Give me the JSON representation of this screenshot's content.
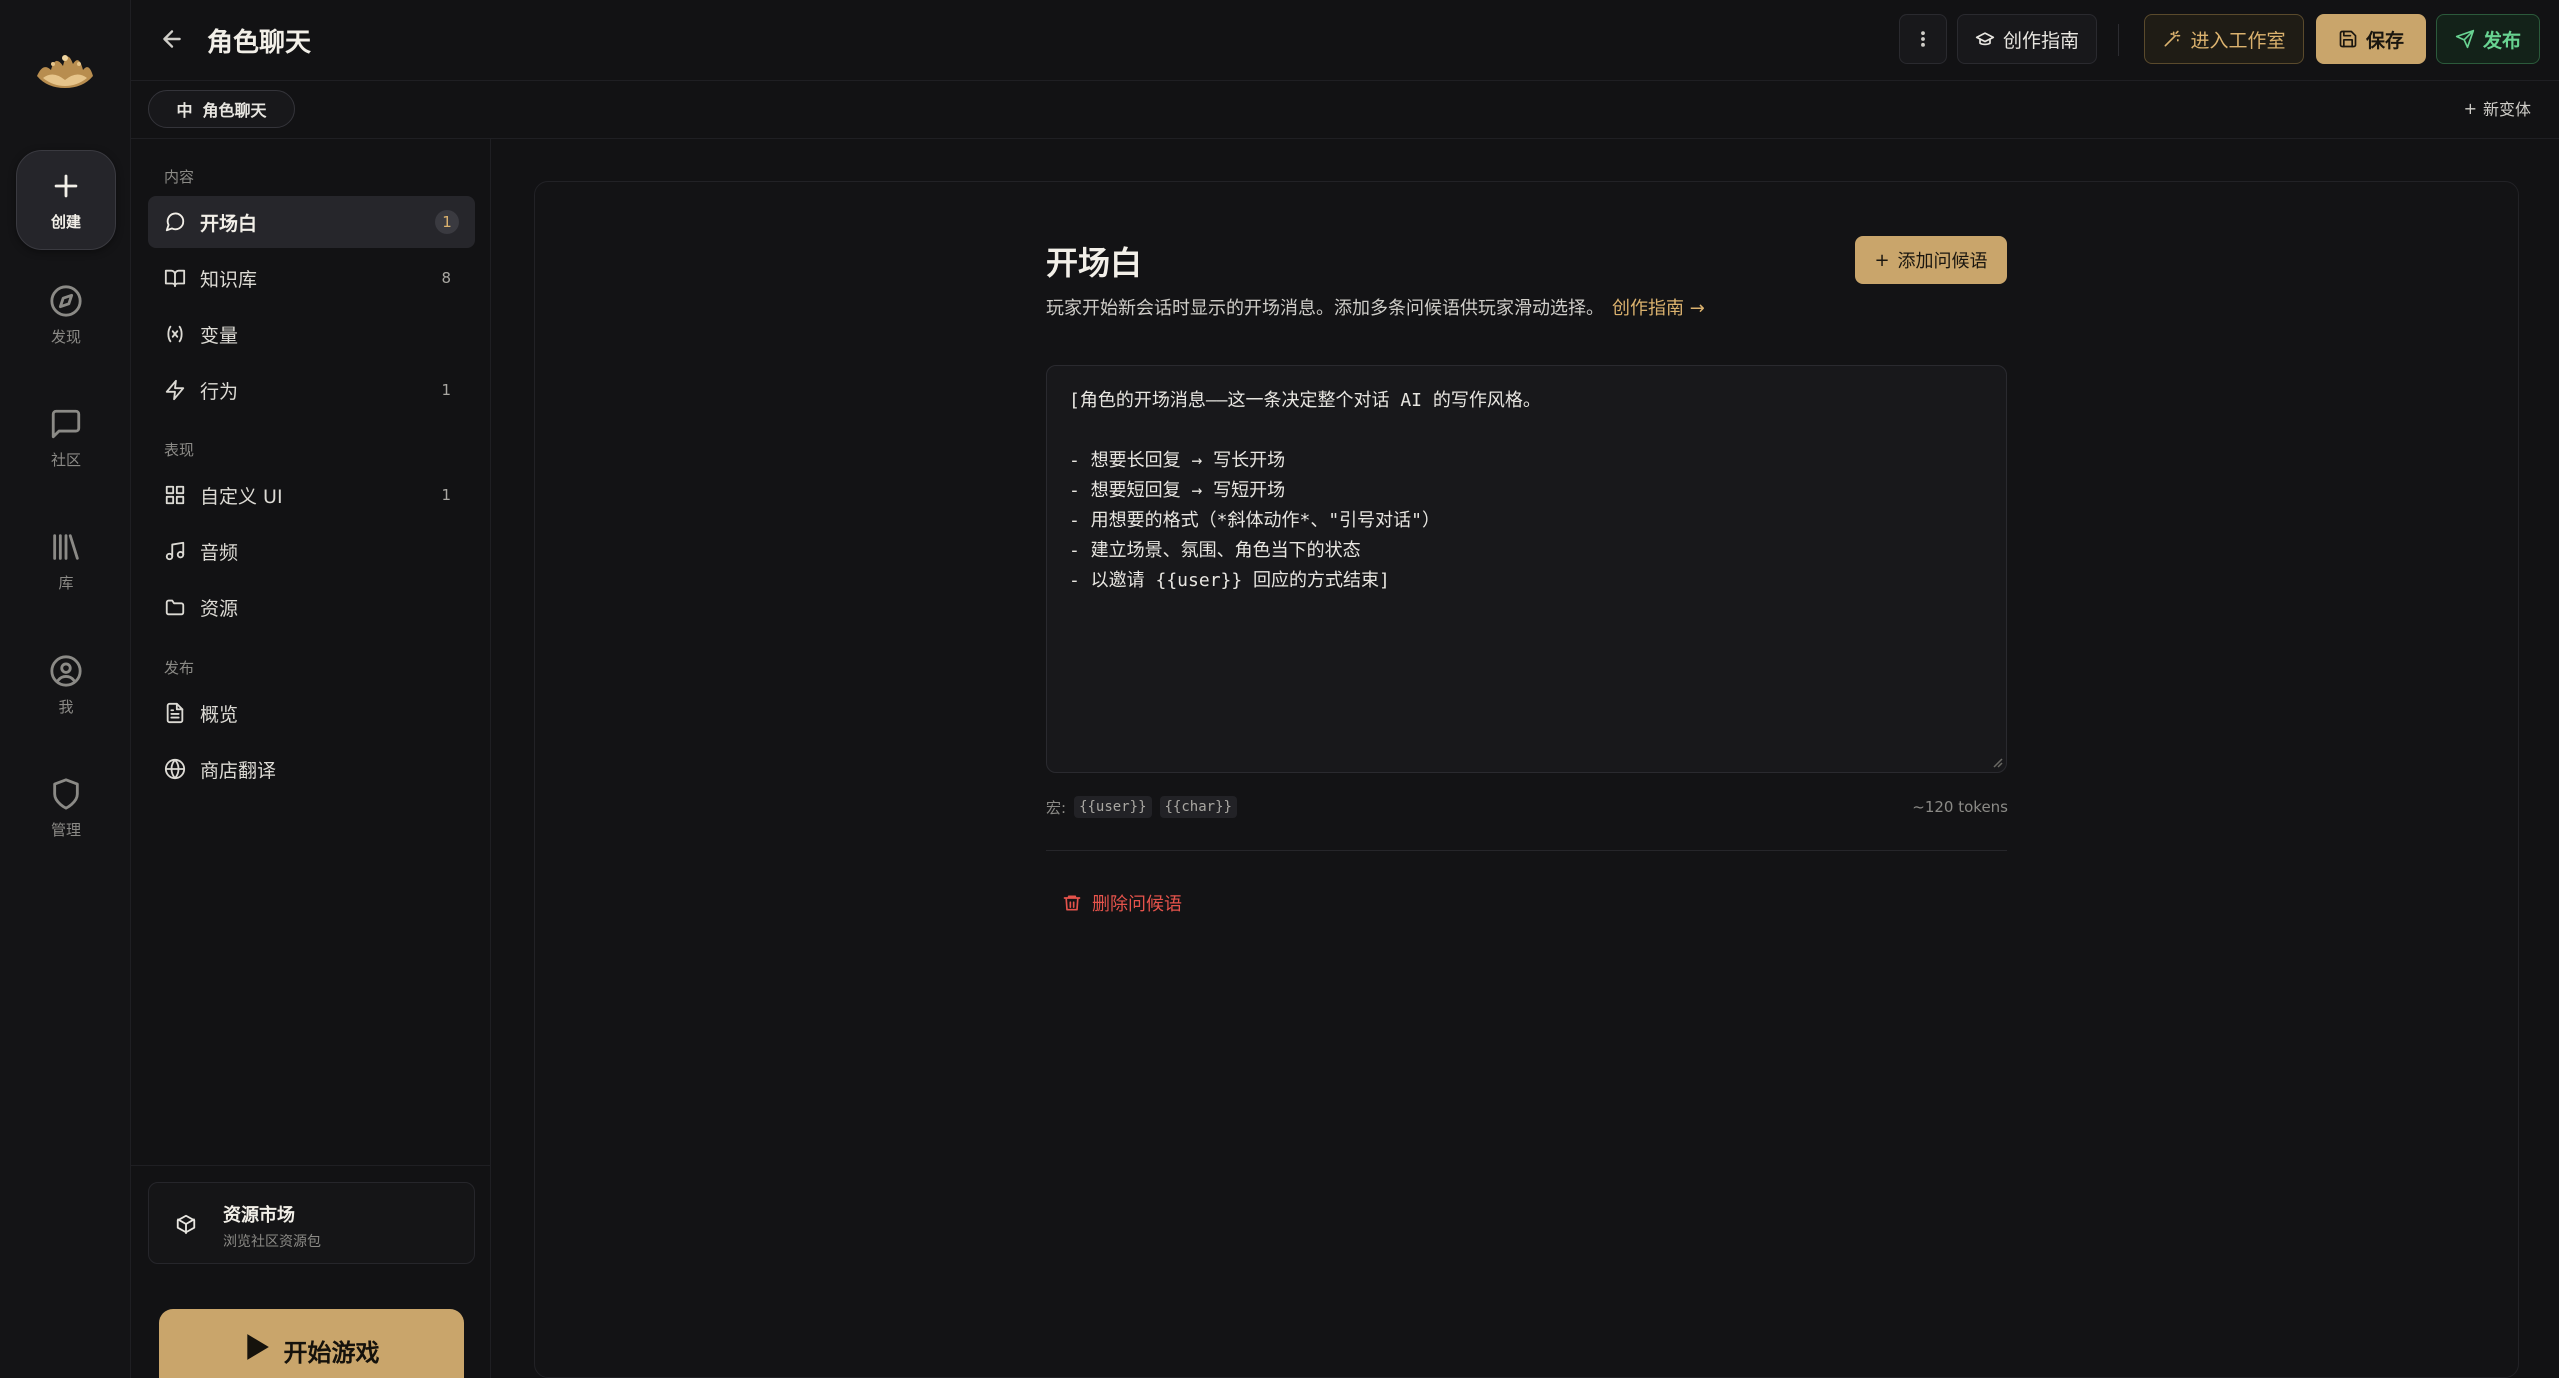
{
  "rail": {
    "items": [
      {
        "label": "创建",
        "icon": "plus-icon",
        "active": true
      },
      {
        "label": "发现",
        "icon": "compass-icon"
      },
      {
        "label": "社区",
        "icon": "chat-bubble-icon"
      },
      {
        "label": "库",
        "icon": "library-icon"
      },
      {
        "label": "我",
        "icon": "user-circle-icon"
      },
      {
        "label": "管理",
        "icon": "shield-icon"
      }
    ]
  },
  "header": {
    "title": "角色聊天",
    "guide_label": "创作指南",
    "studio_label": "进入工作室",
    "save_label": "保存",
    "publish_label": "发布"
  },
  "variant": {
    "chip_prefix": "中",
    "chip_label": "角色聊天",
    "new_label": "新变体"
  },
  "sidebar": {
    "sections": [
      "内容",
      "表现",
      "发布"
    ],
    "items": [
      {
        "label": "开场白",
        "count": "1",
        "icon": "message-circle-icon",
        "active": true
      },
      {
        "label": "知识库",
        "count": "8",
        "icon": "book-open-icon"
      },
      {
        "label": "变量",
        "count": "",
        "icon": "variable-icon"
      },
      {
        "label": "行为",
        "count": "1",
        "icon": "lightning-icon"
      },
      {
        "label": "自定义 UI",
        "count": "1",
        "icon": "grid-icon"
      },
      {
        "label": "音频",
        "count": "",
        "icon": "music-icon"
      },
      {
        "label": "资源",
        "count": "",
        "icon": "folder-icon"
      },
      {
        "label": "概览",
        "count": "",
        "icon": "file-text-icon"
      },
      {
        "label": "商店翻译",
        "count": "",
        "icon": "globe-icon"
      }
    ],
    "market": {
      "title": "资源市场",
      "subtitle": "浏览社区资源包"
    },
    "play_label": "开始游戏"
  },
  "main": {
    "title": "开场白",
    "description": "玩家开始新会话时显示的开场消息。添加多条问候语供玩家滑动选择。",
    "guide_link": "创作指南 →",
    "add_label": "添加问候语",
    "editor_text": "[角色的开场消息——这一条决定整个对话 AI 的写作风格。\n\n- 想要长回复 → 写长开场\n- 想要短回复 → 写短开场\n- 用想要的格式（*斜体动作*、\"引号对话\"）\n- 建立场景、氛围、角色当下的状态\n- 以邀请 {{user}} 回应的方式结束]",
    "macro_label": "宏:",
    "macros": [
      "{{user}}",
      "{{char}}"
    ],
    "tokens": "~120 tokens",
    "delete_label": "删除问候语"
  },
  "colors": {
    "accent": "#c9a56b",
    "publish": "#68d391",
    "danger": "#e5534b"
  }
}
